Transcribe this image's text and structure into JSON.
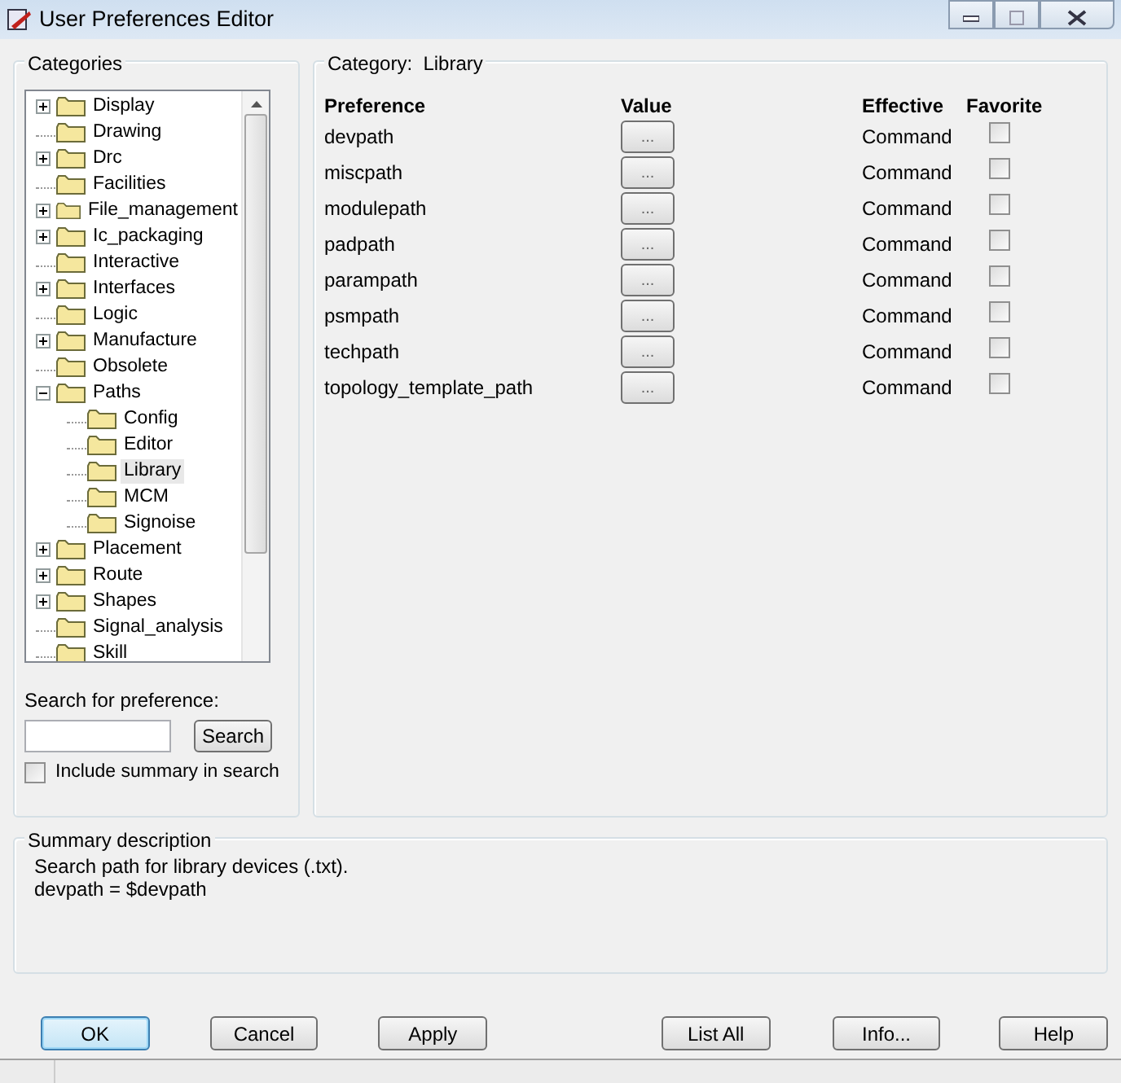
{
  "window": {
    "title": "User Preferences Editor"
  },
  "categories": {
    "title": "Categories",
    "tree": [
      {
        "label": "Display",
        "kind": "group",
        "expanded": false,
        "selected": false
      },
      {
        "label": "Drawing",
        "kind": "leaf",
        "selected": false
      },
      {
        "label": "Drc",
        "kind": "group",
        "expanded": false,
        "selected": false
      },
      {
        "label": "Facilities",
        "kind": "leaf",
        "selected": false
      },
      {
        "label": "File_management",
        "kind": "group",
        "expanded": false,
        "selected": false
      },
      {
        "label": "Ic_packaging",
        "kind": "group",
        "expanded": false,
        "selected": false
      },
      {
        "label": "Interactive",
        "kind": "leaf",
        "selected": false
      },
      {
        "label": "Interfaces",
        "kind": "group",
        "expanded": false,
        "selected": false
      },
      {
        "label": "Logic",
        "kind": "leaf",
        "selected": false
      },
      {
        "label": "Manufacture",
        "kind": "group",
        "expanded": false,
        "selected": false
      },
      {
        "label": "Obsolete",
        "kind": "leaf",
        "selected": false
      },
      {
        "label": "Paths",
        "kind": "group",
        "expanded": true,
        "selected": false,
        "children": [
          {
            "label": "Config",
            "kind": "leaf",
            "selected": false
          },
          {
            "label": "Editor",
            "kind": "leaf",
            "selected": false
          },
          {
            "label": "Library",
            "kind": "leaf",
            "selected": true
          },
          {
            "label": "MCM",
            "kind": "leaf",
            "selected": false
          },
          {
            "label": "Signoise",
            "kind": "leaf",
            "selected": false
          }
        ]
      },
      {
        "label": "Placement",
        "kind": "group",
        "expanded": false,
        "selected": false
      },
      {
        "label": "Route",
        "kind": "group",
        "expanded": false,
        "selected": false
      },
      {
        "label": "Shapes",
        "kind": "group",
        "expanded": false,
        "selected": false
      },
      {
        "label": "Signal_analysis",
        "kind": "leaf",
        "selected": false
      },
      {
        "label": "Skill",
        "kind": "leaf",
        "selected": false
      }
    ],
    "search_label": "Search for preference:",
    "search_button": "Search",
    "include_summary": {
      "label": "Include summary in search",
      "checked": false
    }
  },
  "category": {
    "caption": "Category:",
    "name": "Library"
  },
  "table": {
    "columns": [
      "Preference",
      "Value",
      "Effective",
      "Favorite"
    ],
    "rows": [
      {
        "preference": "devpath",
        "value": "...",
        "effective": "Command",
        "favorite": false
      },
      {
        "preference": "miscpath",
        "value": "...",
        "effective": "Command",
        "favorite": false
      },
      {
        "preference": "modulepath",
        "value": "...",
        "effective": "Command",
        "favorite": false
      },
      {
        "preference": "padpath",
        "value": "...",
        "effective": "Command",
        "favorite": false
      },
      {
        "preference": "parampath",
        "value": "...",
        "effective": "Command",
        "favorite": false
      },
      {
        "preference": "psmpath",
        "value": "...",
        "effective": "Command",
        "favorite": false
      },
      {
        "preference": "techpath",
        "value": "...",
        "effective": "Command",
        "favorite": false
      },
      {
        "preference": "topology_template_path",
        "value": "...",
        "effective": "Command",
        "favorite": false
      }
    ]
  },
  "summary": {
    "title": "Summary description",
    "lines": [
      "Search path for library devices (.txt).",
      "devpath = $devpath"
    ]
  },
  "buttons": [
    {
      "label": "OK",
      "default": true
    },
    {
      "label": "Cancel",
      "default": false
    },
    {
      "label": "Apply",
      "default": false
    },
    {
      "label": "List All",
      "default": false
    },
    {
      "label": "Info...",
      "default": false
    },
    {
      "label": "Help",
      "default": false
    }
  ]
}
